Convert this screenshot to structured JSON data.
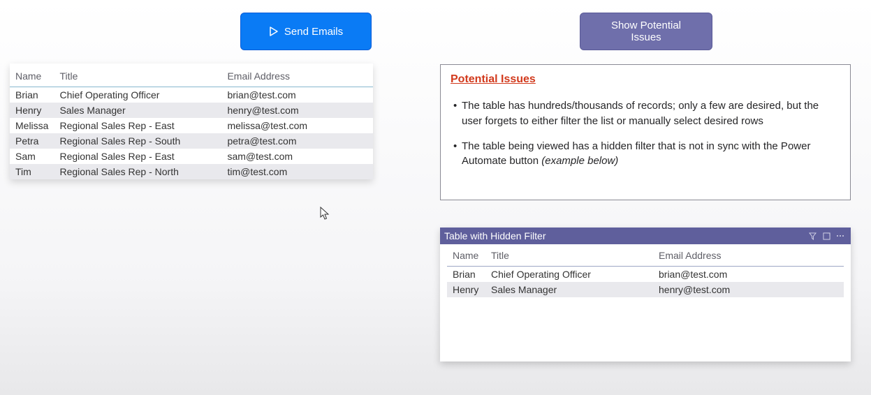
{
  "buttons": {
    "send_emails": "Send Emails",
    "show_issues": "Show Potential Issues"
  },
  "left_table": {
    "headers": {
      "name": "Name",
      "title": "Title",
      "email": "Email Address"
    },
    "rows": [
      {
        "name": "Brian",
        "title": "Chief Operating Officer",
        "email": "brian@test.com"
      },
      {
        "name": "Henry",
        "title": "Sales Manager",
        "email": "henry@test.com"
      },
      {
        "name": "Melissa",
        "title": "Regional Sales Rep - East",
        "email": "melissa@test.com"
      },
      {
        "name": "Petra",
        "title": "Regional Sales Rep - South",
        "email": "petra@test.com"
      },
      {
        "name": "Sam",
        "title": "Regional Sales Rep - East",
        "email": "sam@test.com"
      },
      {
        "name": "Tim",
        "title": "Regional Sales Rep - North",
        "email": "tim@test.com"
      }
    ]
  },
  "issues_panel": {
    "title": "Potential Issues",
    "items": [
      "The table has hundreds/thousands of records; only a few are desired, but the user forgets to either filter the list or manually select desired rows",
      "The table being viewed has a hidden filter that is not in sync with the Power Automate button "
    ],
    "item2_em": "(example below)"
  },
  "filtered_table": {
    "title": "Table with Hidden Filter",
    "headers": {
      "name": "Name",
      "title": "Title",
      "email": "Email Address"
    },
    "rows": [
      {
        "name": "Brian",
        "title": "Chief Operating Officer",
        "email": "brian@test.com"
      },
      {
        "name": "Henry",
        "title": "Sales Manager",
        "email": "henry@test.com"
      }
    ]
  }
}
